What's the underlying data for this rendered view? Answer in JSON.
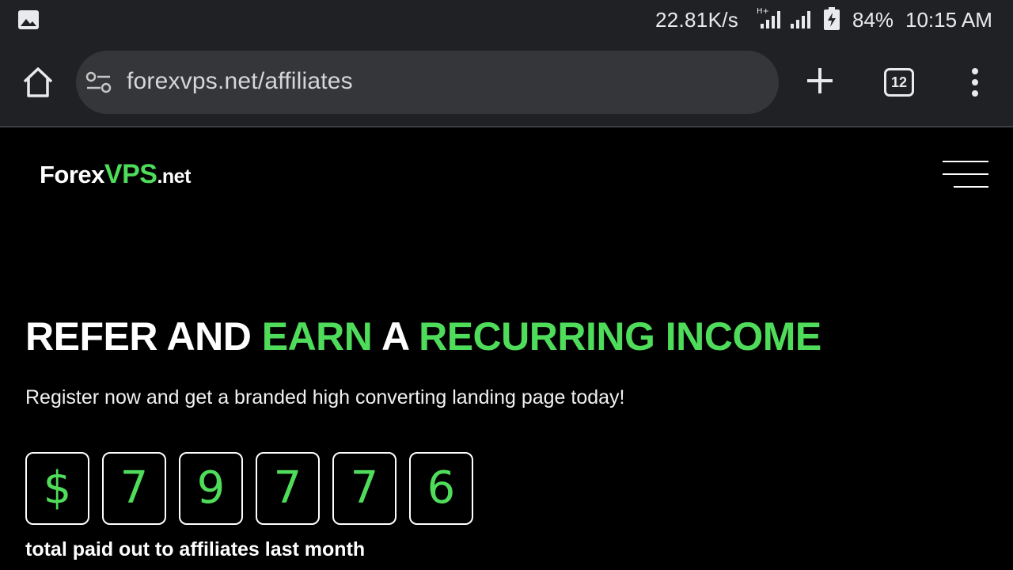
{
  "status_bar": {
    "network_speed": "22.81K/s",
    "network_type": "H+",
    "battery_percent": "84%",
    "time": "10:15 AM",
    "icons": [
      "gallery-icon",
      "signal-icon",
      "battery-charging-icon"
    ]
  },
  "browser": {
    "url": "forexvps.net/affiliates",
    "tab_count": "12",
    "icons": [
      "home-icon",
      "site-settings-icon",
      "plus-icon",
      "tabs-icon",
      "more-vert-icon"
    ]
  },
  "site": {
    "logo": {
      "forex": "Forex",
      "vps": "VPS",
      "net": ".net"
    },
    "menu_icon": "hamburger-icon",
    "hero": {
      "title_parts": {
        "p1": "REFER AND ",
        "p2": "EARN",
        "p3": " A ",
        "p4": "RECURRING INCOME"
      },
      "subtitle": "Register now and get a branded high converting landing page today!",
      "counter": {
        "digits": [
          "$",
          "7",
          "9",
          "7",
          "7",
          "6"
        ],
        "label": "total paid out to affiliates last month"
      }
    }
  },
  "colors": {
    "accent_green": "#4fdc5a",
    "toolbar_bg": "#202124",
    "url_box_bg": "#35363a",
    "page_bg": "#000000"
  }
}
